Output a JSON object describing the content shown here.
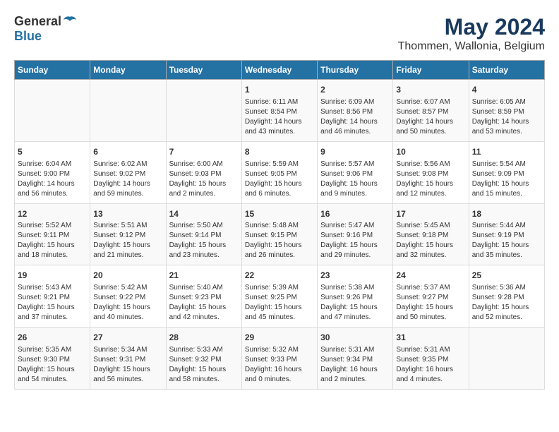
{
  "logo": {
    "general": "General",
    "blue": "Blue"
  },
  "title": "May 2024",
  "subtitle": "Thommen, Wallonia, Belgium",
  "days_header": [
    "Sunday",
    "Monday",
    "Tuesday",
    "Wednesday",
    "Thursday",
    "Friday",
    "Saturday"
  ],
  "weeks": [
    [
      {
        "day": "",
        "content": ""
      },
      {
        "day": "",
        "content": ""
      },
      {
        "day": "",
        "content": ""
      },
      {
        "day": "1",
        "content": "Sunrise: 6:11 AM\nSunset: 8:54 PM\nDaylight: 14 hours\nand 43 minutes."
      },
      {
        "day": "2",
        "content": "Sunrise: 6:09 AM\nSunset: 8:56 PM\nDaylight: 14 hours\nand 46 minutes."
      },
      {
        "day": "3",
        "content": "Sunrise: 6:07 AM\nSunset: 8:57 PM\nDaylight: 14 hours\nand 50 minutes."
      },
      {
        "day": "4",
        "content": "Sunrise: 6:05 AM\nSunset: 8:59 PM\nDaylight: 14 hours\nand 53 minutes."
      }
    ],
    [
      {
        "day": "5",
        "content": "Sunrise: 6:04 AM\nSunset: 9:00 PM\nDaylight: 14 hours\nand 56 minutes."
      },
      {
        "day": "6",
        "content": "Sunrise: 6:02 AM\nSunset: 9:02 PM\nDaylight: 14 hours\nand 59 minutes."
      },
      {
        "day": "7",
        "content": "Sunrise: 6:00 AM\nSunset: 9:03 PM\nDaylight: 15 hours\nand 2 minutes."
      },
      {
        "day": "8",
        "content": "Sunrise: 5:59 AM\nSunset: 9:05 PM\nDaylight: 15 hours\nand 6 minutes."
      },
      {
        "day": "9",
        "content": "Sunrise: 5:57 AM\nSunset: 9:06 PM\nDaylight: 15 hours\nand 9 minutes."
      },
      {
        "day": "10",
        "content": "Sunrise: 5:56 AM\nSunset: 9:08 PM\nDaylight: 15 hours\nand 12 minutes."
      },
      {
        "day": "11",
        "content": "Sunrise: 5:54 AM\nSunset: 9:09 PM\nDaylight: 15 hours\nand 15 minutes."
      }
    ],
    [
      {
        "day": "12",
        "content": "Sunrise: 5:52 AM\nSunset: 9:11 PM\nDaylight: 15 hours\nand 18 minutes."
      },
      {
        "day": "13",
        "content": "Sunrise: 5:51 AM\nSunset: 9:12 PM\nDaylight: 15 hours\nand 21 minutes."
      },
      {
        "day": "14",
        "content": "Sunrise: 5:50 AM\nSunset: 9:14 PM\nDaylight: 15 hours\nand 23 minutes."
      },
      {
        "day": "15",
        "content": "Sunrise: 5:48 AM\nSunset: 9:15 PM\nDaylight: 15 hours\nand 26 minutes."
      },
      {
        "day": "16",
        "content": "Sunrise: 5:47 AM\nSunset: 9:16 PM\nDaylight: 15 hours\nand 29 minutes."
      },
      {
        "day": "17",
        "content": "Sunrise: 5:45 AM\nSunset: 9:18 PM\nDaylight: 15 hours\nand 32 minutes."
      },
      {
        "day": "18",
        "content": "Sunrise: 5:44 AM\nSunset: 9:19 PM\nDaylight: 15 hours\nand 35 minutes."
      }
    ],
    [
      {
        "day": "19",
        "content": "Sunrise: 5:43 AM\nSunset: 9:21 PM\nDaylight: 15 hours\nand 37 minutes."
      },
      {
        "day": "20",
        "content": "Sunrise: 5:42 AM\nSunset: 9:22 PM\nDaylight: 15 hours\nand 40 minutes."
      },
      {
        "day": "21",
        "content": "Sunrise: 5:40 AM\nSunset: 9:23 PM\nDaylight: 15 hours\nand 42 minutes."
      },
      {
        "day": "22",
        "content": "Sunrise: 5:39 AM\nSunset: 9:25 PM\nDaylight: 15 hours\nand 45 minutes."
      },
      {
        "day": "23",
        "content": "Sunrise: 5:38 AM\nSunset: 9:26 PM\nDaylight: 15 hours\nand 47 minutes."
      },
      {
        "day": "24",
        "content": "Sunrise: 5:37 AM\nSunset: 9:27 PM\nDaylight: 15 hours\nand 50 minutes."
      },
      {
        "day": "25",
        "content": "Sunrise: 5:36 AM\nSunset: 9:28 PM\nDaylight: 15 hours\nand 52 minutes."
      }
    ],
    [
      {
        "day": "26",
        "content": "Sunrise: 5:35 AM\nSunset: 9:30 PM\nDaylight: 15 hours\nand 54 minutes."
      },
      {
        "day": "27",
        "content": "Sunrise: 5:34 AM\nSunset: 9:31 PM\nDaylight: 15 hours\nand 56 minutes."
      },
      {
        "day": "28",
        "content": "Sunrise: 5:33 AM\nSunset: 9:32 PM\nDaylight: 15 hours\nand 58 minutes."
      },
      {
        "day": "29",
        "content": "Sunrise: 5:32 AM\nSunset: 9:33 PM\nDaylight: 16 hours\nand 0 minutes."
      },
      {
        "day": "30",
        "content": "Sunrise: 5:31 AM\nSunset: 9:34 PM\nDaylight: 16 hours\nand 2 minutes."
      },
      {
        "day": "31",
        "content": "Sunrise: 5:31 AM\nSunset: 9:35 PM\nDaylight: 16 hours\nand 4 minutes."
      },
      {
        "day": "",
        "content": ""
      }
    ]
  ]
}
